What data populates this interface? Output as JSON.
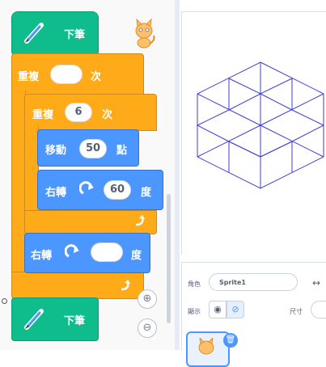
{
  "script": {
    "pen_down_label": "下筆",
    "repeat_outer_label": "重複",
    "repeat_outer_count": "",
    "repeat_outer_unit": "次",
    "repeat_inner_label": "重複",
    "repeat_inner_count": "6",
    "repeat_inner_unit": "次",
    "move_label": "移動",
    "move_steps": "50",
    "move_unit": "點",
    "turn_inner_label": "右轉",
    "turn_inner_degrees": "60",
    "turn_inner_unit": "度",
    "turn_outer_label": "右轉",
    "turn_outer_degrees": "",
    "turn_outer_unit": "度",
    "pen_up_label": "下筆"
  },
  "zoom": {
    "in_symbol": "⊕",
    "out_symbol": "⊖"
  },
  "sprite_info": {
    "sprite_label": "角色",
    "sprite_name": "Sprite1",
    "show_label": "顯示",
    "size_label": "尺寸",
    "arrows": "↔"
  },
  "colors": {
    "pen": "#0fbd8c",
    "control": "#ffab19",
    "motion": "#4c97ff",
    "drawing": "#3c3cd6"
  }
}
